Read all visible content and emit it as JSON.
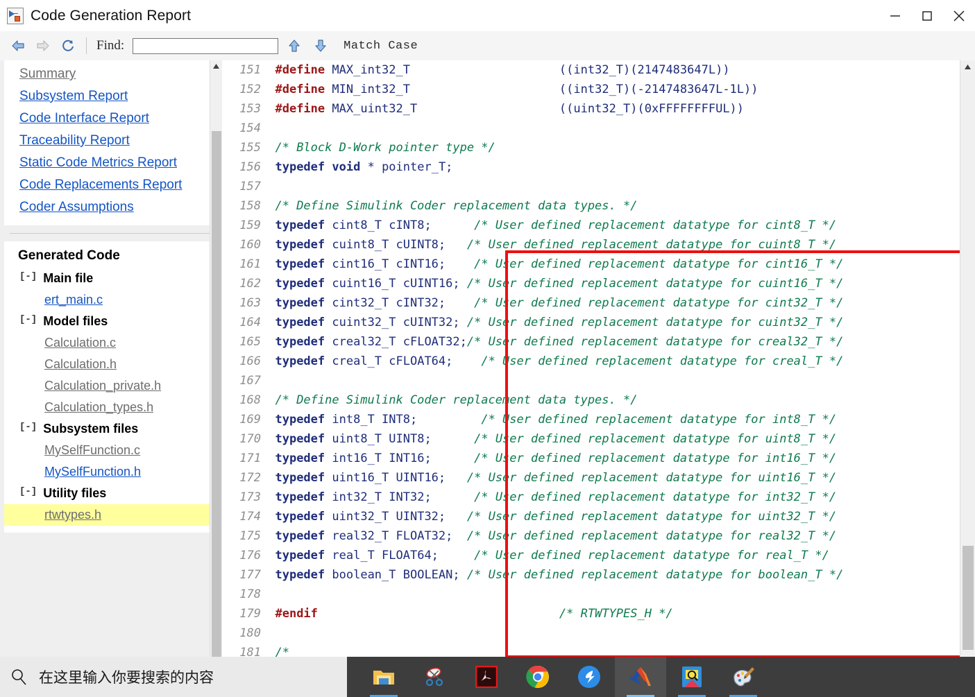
{
  "window": {
    "title": "Code Generation Report",
    "icon": "simulink-model-icon",
    "minimize_label": "Minimize",
    "maximize_label": "Maximize",
    "close_label": "Close"
  },
  "toolbar": {
    "back_label": "Back",
    "forward_label": "Forward",
    "refresh_label": "Refresh",
    "find_label": "Find:",
    "find_value": "",
    "find_placeholder": "",
    "find_prev_label": "Find Previous",
    "find_next_label": "Find Next",
    "match_case_label": "Match Case"
  },
  "sidebar": {
    "report_links": [
      {
        "label": "Summary",
        "state": "visited"
      },
      {
        "label": "Subsystem Report",
        "state": "link"
      },
      {
        "label": "Code Interface Report",
        "state": "link"
      },
      {
        "label": "Traceability Report",
        "state": "link"
      },
      {
        "label": "Static Code Metrics Report",
        "state": "link"
      },
      {
        "label": "Code Replacements Report",
        "state": "link"
      },
      {
        "label": "Coder Assumptions",
        "state": "link"
      }
    ],
    "generated_code_title": "Generated Code",
    "toggle_glyph": "[-]",
    "groups": [
      {
        "label": "Main file",
        "files": [
          {
            "label": "ert_main.c",
            "state": "link"
          }
        ]
      },
      {
        "label": "Model files",
        "files": [
          {
            "label": "Calculation.c",
            "state": "visited"
          },
          {
            "label": "Calculation.h",
            "state": "visited"
          },
          {
            "label": "Calculation_private.h",
            "state": "visited"
          },
          {
            "label": "Calculation_types.h",
            "state": "visited"
          }
        ]
      },
      {
        "label": "Subsystem files",
        "files": [
          {
            "label": "MySelfFunction.c",
            "state": "visited"
          },
          {
            "label": "MySelfFunction.h",
            "state": "link"
          }
        ]
      },
      {
        "label": "Utility files",
        "files": [
          {
            "label": "rtwtypes.h",
            "state": "visited",
            "highlighted": true
          }
        ]
      }
    ]
  },
  "code": {
    "first_line_number": 151,
    "lines": [
      {
        "n": 151,
        "tokens": [
          {
            "t": "pp",
            "v": "#define"
          },
          {
            "t": "sp",
            "v": " "
          },
          {
            "t": "id",
            "v": "MAX_int32_T"
          },
          {
            "t": "sp",
            "v": "                     "
          },
          {
            "t": "val",
            "v": "((int32_T)(2147483647L))"
          }
        ]
      },
      {
        "n": 152,
        "tokens": [
          {
            "t": "pp",
            "v": "#define"
          },
          {
            "t": "sp",
            "v": " "
          },
          {
            "t": "id",
            "v": "MIN_int32_T"
          },
          {
            "t": "sp",
            "v": "                     "
          },
          {
            "t": "val",
            "v": "((int32_T)(-2147483647L-1L))"
          }
        ]
      },
      {
        "n": 153,
        "tokens": [
          {
            "t": "pp",
            "v": "#define"
          },
          {
            "t": "sp",
            "v": " "
          },
          {
            "t": "id",
            "v": "MAX_uint32_T"
          },
          {
            "t": "sp",
            "v": "                    "
          },
          {
            "t": "val",
            "v": "((uint32_T)(0xFFFFFFFFUL))"
          }
        ]
      },
      {
        "n": 154,
        "tokens": []
      },
      {
        "n": 155,
        "tokens": [
          {
            "t": "cm",
            "v": "/* Block D-Work pointer type */"
          }
        ]
      },
      {
        "n": 156,
        "tokens": [
          {
            "t": "kw",
            "v": "typedef"
          },
          {
            "t": "sp",
            "v": " "
          },
          {
            "t": "kw",
            "v": "void"
          },
          {
            "t": "sp",
            "v": " "
          },
          {
            "t": "id",
            "v": "* pointer_T;"
          }
        ]
      },
      {
        "n": 157,
        "tokens": []
      },
      {
        "n": 158,
        "tokens": [
          {
            "t": "cm",
            "v": "/* Define Simulink Coder replacement data types. */"
          }
        ]
      },
      {
        "n": 159,
        "tokens": [
          {
            "t": "kw",
            "v": "typedef"
          },
          {
            "t": "sp",
            "v": " "
          },
          {
            "t": "id",
            "v": "cint8_T cINT8;"
          },
          {
            "t": "sp",
            "v": "      "
          },
          {
            "t": "cm",
            "v": "/* User defined replacement datatype for cint8_T */"
          }
        ]
      },
      {
        "n": 160,
        "tokens": [
          {
            "t": "kw",
            "v": "typedef"
          },
          {
            "t": "sp",
            "v": " "
          },
          {
            "t": "id",
            "v": "cuint8_T cUINT8;"
          },
          {
            "t": "sp",
            "v": "   "
          },
          {
            "t": "cm",
            "v": "/* User defined replacement datatype for cuint8_T */"
          }
        ]
      },
      {
        "n": 161,
        "tokens": [
          {
            "t": "kw",
            "v": "typedef"
          },
          {
            "t": "sp",
            "v": " "
          },
          {
            "t": "id",
            "v": "cint16_T cINT16;"
          },
          {
            "t": "sp",
            "v": "    "
          },
          {
            "t": "cm",
            "v": "/* User defined replacement datatype for cint16_T */"
          }
        ]
      },
      {
        "n": 162,
        "tokens": [
          {
            "t": "kw",
            "v": "typedef"
          },
          {
            "t": "sp",
            "v": " "
          },
          {
            "t": "id",
            "v": "cuint16_T cUINT16;"
          },
          {
            "t": "sp",
            "v": " "
          },
          {
            "t": "cm",
            "v": "/* User defined replacement datatype for cuint16_T */"
          }
        ]
      },
      {
        "n": 163,
        "tokens": [
          {
            "t": "kw",
            "v": "typedef"
          },
          {
            "t": "sp",
            "v": " "
          },
          {
            "t": "id",
            "v": "cint32_T cINT32;"
          },
          {
            "t": "sp",
            "v": "    "
          },
          {
            "t": "cm",
            "v": "/* User defined replacement datatype for cint32_T */"
          }
        ]
      },
      {
        "n": 164,
        "tokens": [
          {
            "t": "kw",
            "v": "typedef"
          },
          {
            "t": "sp",
            "v": " "
          },
          {
            "t": "id",
            "v": "cuint32_T cUINT32;"
          },
          {
            "t": "sp",
            "v": " "
          },
          {
            "t": "cm",
            "v": "/* User defined replacement datatype for cuint32_T */"
          }
        ]
      },
      {
        "n": 165,
        "tokens": [
          {
            "t": "kw",
            "v": "typedef"
          },
          {
            "t": "sp",
            "v": " "
          },
          {
            "t": "id",
            "v": "creal32_T cFLOAT32;"
          },
          {
            "t": "sp",
            "v": ""
          },
          {
            "t": "cm",
            "v": "/* User defined replacement datatype for creal32_T */"
          }
        ]
      },
      {
        "n": 166,
        "tokens": [
          {
            "t": "kw",
            "v": "typedef"
          },
          {
            "t": "sp",
            "v": " "
          },
          {
            "t": "id",
            "v": "creal_T cFLOAT64;"
          },
          {
            "t": "sp",
            "v": "    "
          },
          {
            "t": "cm",
            "v": "/* User defined replacement datatype for creal_T */"
          }
        ]
      },
      {
        "n": 167,
        "tokens": []
      },
      {
        "n": 168,
        "tokens": [
          {
            "t": "cm",
            "v": "/* Define Simulink Coder replacement data types. */"
          }
        ]
      },
      {
        "n": 169,
        "tokens": [
          {
            "t": "kw",
            "v": "typedef"
          },
          {
            "t": "sp",
            "v": " "
          },
          {
            "t": "id",
            "v": "int8_T INT8;"
          },
          {
            "t": "sp",
            "v": "         "
          },
          {
            "t": "cm",
            "v": "/* User defined replacement datatype for int8_T */"
          }
        ]
      },
      {
        "n": 170,
        "tokens": [
          {
            "t": "kw",
            "v": "typedef"
          },
          {
            "t": "sp",
            "v": " "
          },
          {
            "t": "id",
            "v": "uint8_T UINT8;"
          },
          {
            "t": "sp",
            "v": "      "
          },
          {
            "t": "cm",
            "v": "/* User defined replacement datatype for uint8_T */"
          }
        ]
      },
      {
        "n": 171,
        "tokens": [
          {
            "t": "kw",
            "v": "typedef"
          },
          {
            "t": "sp",
            "v": " "
          },
          {
            "t": "id",
            "v": "int16_T INT16;"
          },
          {
            "t": "sp",
            "v": "      "
          },
          {
            "t": "cm",
            "v": "/* User defined replacement datatype for int16_T */"
          }
        ]
      },
      {
        "n": 172,
        "tokens": [
          {
            "t": "kw",
            "v": "typedef"
          },
          {
            "t": "sp",
            "v": " "
          },
          {
            "t": "id",
            "v": "uint16_T UINT16;"
          },
          {
            "t": "sp",
            "v": "   "
          },
          {
            "t": "cm",
            "v": "/* User defined replacement datatype for uint16_T */"
          }
        ]
      },
      {
        "n": 173,
        "tokens": [
          {
            "t": "kw",
            "v": "typedef"
          },
          {
            "t": "sp",
            "v": " "
          },
          {
            "t": "id",
            "v": "int32_T INT32;"
          },
          {
            "t": "sp",
            "v": "      "
          },
          {
            "t": "cm",
            "v": "/* User defined replacement datatype for int32_T */"
          }
        ]
      },
      {
        "n": 174,
        "tokens": [
          {
            "t": "kw",
            "v": "typedef"
          },
          {
            "t": "sp",
            "v": " "
          },
          {
            "t": "id",
            "v": "uint32_T UINT32;"
          },
          {
            "t": "sp",
            "v": "   "
          },
          {
            "t": "cm",
            "v": "/* User defined replacement datatype for uint32_T */"
          }
        ]
      },
      {
        "n": 175,
        "tokens": [
          {
            "t": "kw",
            "v": "typedef"
          },
          {
            "t": "sp",
            "v": " "
          },
          {
            "t": "id",
            "v": "real32_T FLOAT32;"
          },
          {
            "t": "sp",
            "v": "  "
          },
          {
            "t": "cm",
            "v": "/* User defined replacement datatype for real32_T */"
          }
        ]
      },
      {
        "n": 176,
        "tokens": [
          {
            "t": "kw",
            "v": "typedef"
          },
          {
            "t": "sp",
            "v": " "
          },
          {
            "t": "id",
            "v": "real_T FLOAT64;"
          },
          {
            "t": "sp",
            "v": "     "
          },
          {
            "t": "cm",
            "v": "/* User defined replacement datatype for real_T */"
          }
        ]
      },
      {
        "n": 177,
        "tokens": [
          {
            "t": "kw",
            "v": "typedef"
          },
          {
            "t": "sp",
            "v": " "
          },
          {
            "t": "id",
            "v": "boolean_T BOOLEAN;"
          },
          {
            "t": "sp",
            "v": " "
          },
          {
            "t": "cm",
            "v": "/* User defined replacement datatype for boolean_T */"
          }
        ]
      },
      {
        "n": 178,
        "tokens": []
      },
      {
        "n": 179,
        "tokens": [
          {
            "t": "pp",
            "v": "#endif"
          },
          {
            "t": "sp",
            "v": "                                  "
          },
          {
            "t": "cm",
            "v": "/* RTWTYPES_H */"
          }
        ]
      },
      {
        "n": 180,
        "tokens": []
      },
      {
        "n": 181,
        "tokens": [
          {
            "t": "cm",
            "v": "/*"
          }
        ]
      }
    ],
    "annotation": {
      "type": "red-rectangle-highlight",
      "color": "#ee0f0f",
      "covers_lines": "158-178"
    }
  },
  "taskbar": {
    "search_placeholder": "在这里输入你要搜索的内容",
    "search_icon": "search-icon",
    "apps": [
      {
        "name": "file-explorer",
        "running": true,
        "active": false
      },
      {
        "name": "snipping-tool",
        "running": false,
        "active": false
      },
      {
        "name": "adobe-acrobat",
        "running": false,
        "active": false
      },
      {
        "name": "google-chrome",
        "running": true,
        "active": false
      },
      {
        "name": "dingtalk",
        "running": true,
        "active": false
      },
      {
        "name": "matlab",
        "running": true,
        "active": true
      },
      {
        "name": "everything-search",
        "running": true,
        "active": false
      },
      {
        "name": "paint",
        "running": true,
        "active": false
      }
    ]
  },
  "colors": {
    "link": "#1455c4",
    "visited_link": "#6d6d6d",
    "highlight": "#ffff9e",
    "annotation_red": "#ee0f0f",
    "comment_green": "#0e7a4e",
    "preprocessor_red": "#9b1616",
    "keyword_blue": "#1f2d7a",
    "taskbar": "#3d3d3d"
  }
}
